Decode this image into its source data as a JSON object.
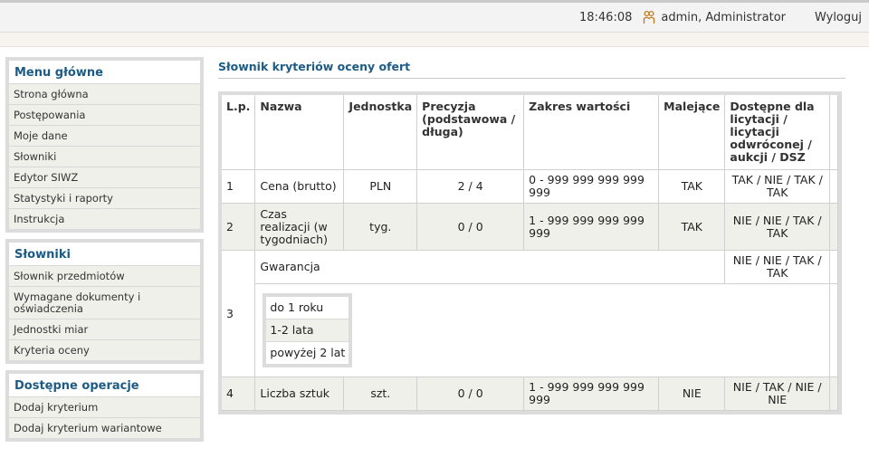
{
  "header": {
    "time": "18:46:08",
    "user": "admin, Administrator",
    "logout": "Wyloguj"
  },
  "sidebar": {
    "main": {
      "title": "Menu główne",
      "items": [
        "Strona główna",
        "Postępowania",
        "Moje dane",
        "Słowniki",
        "Edytor SIWZ",
        "Statystyki i raporty",
        "Instrukcja"
      ]
    },
    "dicts": {
      "title": "Słowniki",
      "items": [
        "Słownik przedmiotów",
        "Wymagane dokumenty i oświadczenia",
        "Jednostki miar",
        "Kryteria oceny"
      ]
    },
    "ops": {
      "title": "Dostępne operacje",
      "items": [
        "Dodaj kryterium",
        "Dodaj kryterium wariantowe"
      ]
    }
  },
  "page": {
    "title": "Słownik kryteriów oceny ofert"
  },
  "table": {
    "headers": [
      "L.p.",
      "Nazwa",
      "Jednostka",
      "Precyzja (podstawowa / długa)",
      "Zakres wartości",
      "Malejące",
      "Dostępne dla licytacji / licytacji odwróconej / aukcji / DSZ"
    ],
    "rows": [
      {
        "lp": "1",
        "name": "Cena (brutto)",
        "unit": "PLN",
        "precision": "2 / 4",
        "range": "0 - 999 999 999 999 999",
        "desc": "TAK",
        "avail": "TAK / NIE / TAK / TAK"
      },
      {
        "lp": "2",
        "name": "Czas realizacji (w tygodniach)",
        "unit": "tyg.",
        "precision": "0 / 0",
        "range": "1 - 999 999 999 999 999",
        "desc": "TAK",
        "avail": "NIE / NIE / TAK / TAK"
      },
      {
        "lp": "3",
        "name": "Gwarancja",
        "avail": "NIE / NIE / TAK / TAK",
        "variants": [
          "do 1 roku",
          "1-2 lata",
          "powyżej 2 lat"
        ]
      },
      {
        "lp": "4",
        "name": "Liczba sztuk",
        "unit": "szt.",
        "precision": "0 / 0",
        "range": "1 - 999 999 999 999 999",
        "desc": "NIE",
        "avail": "NIE / TAK / NIE / NIE"
      }
    ]
  }
}
